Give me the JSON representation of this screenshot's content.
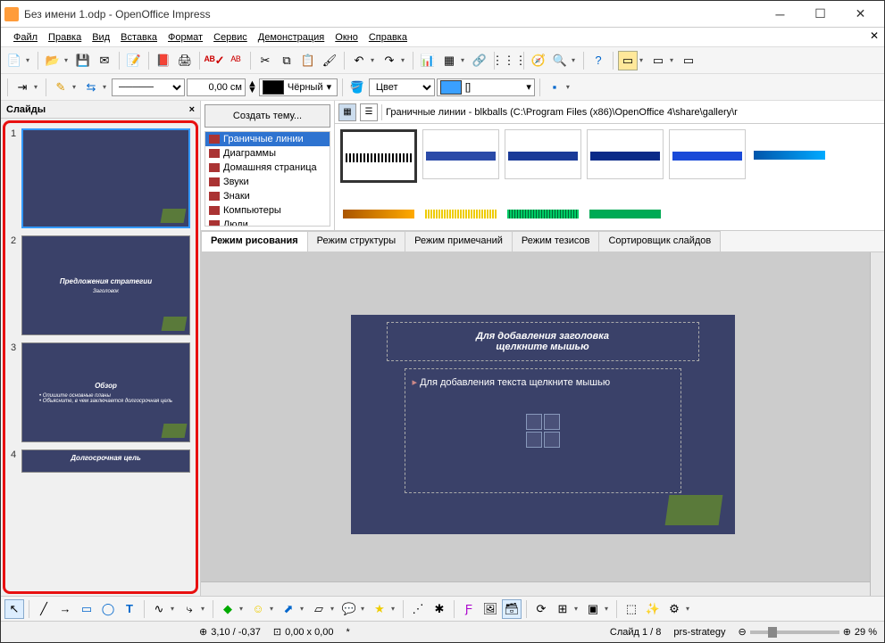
{
  "window": {
    "title": "Без имени 1.odp - OpenOffice Impress"
  },
  "menu": [
    "Файл",
    "Правка",
    "Вид",
    "Вставка",
    "Формат",
    "Сервис",
    "Демонстрация",
    "Окно",
    "Справка"
  ],
  "toolbar2": {
    "width": "0,00 см",
    "color_label": "Чёрный",
    "fill_label": "Цвет",
    "fill_value": "[]"
  },
  "sidepanel": {
    "title": "Слайды"
  },
  "slides": [
    {
      "num": "1",
      "title": "",
      "body": ""
    },
    {
      "num": "2",
      "title": "Предложения стратегии",
      "body": "Заголовок"
    },
    {
      "num": "3",
      "title": "Обзор",
      "body": "• Опишите основные планы\n• Объясните, в чем заключается долгосрочная цель"
    },
    {
      "num": "4",
      "title": "Долгосрочная цель",
      "body": ""
    }
  ],
  "gallery": {
    "create": "Создать тему...",
    "categories": [
      "Граничные линии",
      "Диаграммы",
      "Домашняя страница",
      "Звуки",
      "Знаки",
      "Компьютеры",
      "Люди"
    ],
    "selected": 0,
    "path": "Граничные линии - blkballs (C:\\Program Files (x86)\\OpenOffice 4\\share\\gallery\\r"
  },
  "tabs": [
    "Режим рисования",
    "Режим структуры",
    "Режим примечаний",
    "Режим тезисов",
    "Сортировщик слайдов"
  ],
  "active_tab": 0,
  "canvas": {
    "title1": "Для добавления заголовка",
    "title2": "щелкните мышью",
    "body": "Для добавления текста щелкните мышью"
  },
  "status": {
    "pos": "3,10 / -0,37",
    "size": "0,00 x 0,00",
    "mark": "*",
    "slide": "Слайд 1 / 8",
    "template": "prs-strategy",
    "zoom": "29 %"
  }
}
